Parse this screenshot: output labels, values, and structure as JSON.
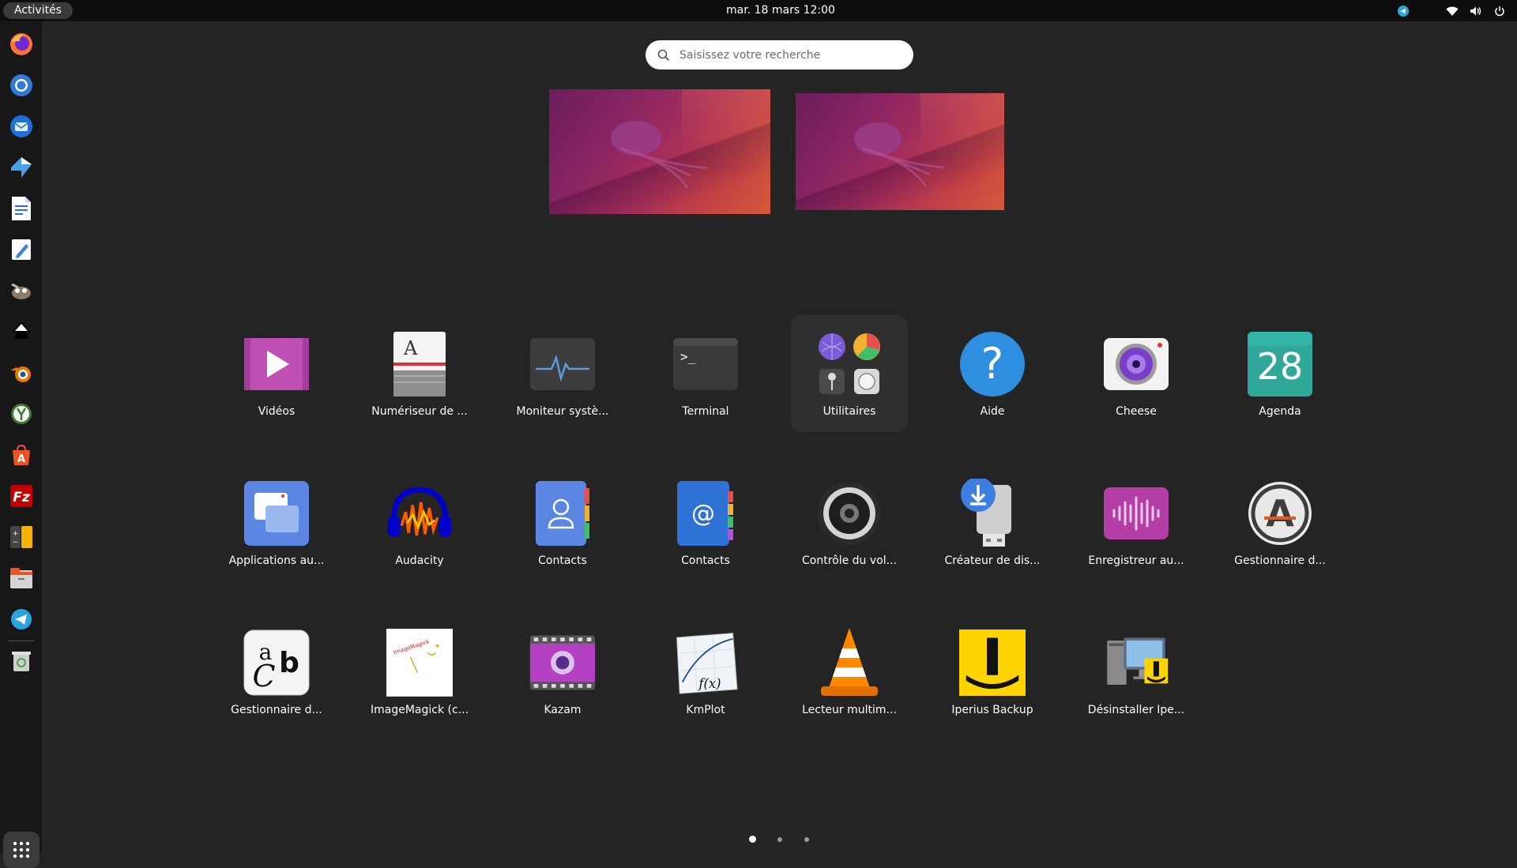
{
  "topbar": {
    "activities": "Activités",
    "clock": "mar. 18 mars  12:00"
  },
  "search": {
    "placeholder": "Saisissez votre recherche"
  },
  "apps": [
    {
      "label": "Vidéos",
      "icon": "videos-icon"
    },
    {
      "label": "Numériseur de ...",
      "icon": "scanner-icon"
    },
    {
      "label": "Moniteur systè...",
      "icon": "system-monitor-icon"
    },
    {
      "label": "Terminal",
      "icon": "terminal-icon"
    },
    {
      "label": "Utilitaires",
      "icon": "utilities-folder-icon"
    },
    {
      "label": "Aide",
      "icon": "help-icon"
    },
    {
      "label": "Cheese",
      "icon": "cheese-camera-icon"
    },
    {
      "label": "Agenda",
      "icon": "calendar-icon",
      "icon_text": "28"
    },
    {
      "label": "Applications au...",
      "icon": "startup-apps-icon"
    },
    {
      "label": "Audacity",
      "icon": "audacity-icon"
    },
    {
      "label": "Contacts",
      "icon": "contacts-icon"
    },
    {
      "label": "Contacts",
      "icon": "contacts-at-icon",
      "icon_text": "@"
    },
    {
      "label": "Contrôle du vol...",
      "icon": "volume-control-icon"
    },
    {
      "label": "Créateur de dis...",
      "icon": "usb-creator-icon"
    },
    {
      "label": "Enregistreur au...",
      "icon": "audio-recorder-icon"
    },
    {
      "label": "Gestionnaire d...",
      "icon": "software-updater-icon",
      "icon_text": "A"
    },
    {
      "label": "Gestionnaire d...",
      "icon": "font-manager-icon"
    },
    {
      "label": "ImageMagick (c...",
      "icon": "imagemagick-icon",
      "icon_text": "ImageMagick"
    },
    {
      "label": "Kazam",
      "icon": "kazam-icon"
    },
    {
      "label": "KmPlot",
      "icon": "kmplot-icon",
      "icon_text": "f(x)"
    },
    {
      "label": "Lecteur multim...",
      "icon": "vlc-icon"
    },
    {
      "label": "Iperius Backup",
      "icon": "iperius-icon"
    },
    {
      "label": "Désinstaller Ipe...",
      "icon": "uninstall-iperius-icon"
    }
  ],
  "pages": {
    "count": 3,
    "current": 1
  },
  "colors": {
    "accent": "#e95420",
    "background": "#242424",
    "topbar": "#0e0e0e",
    "dock": "#171717"
  }
}
